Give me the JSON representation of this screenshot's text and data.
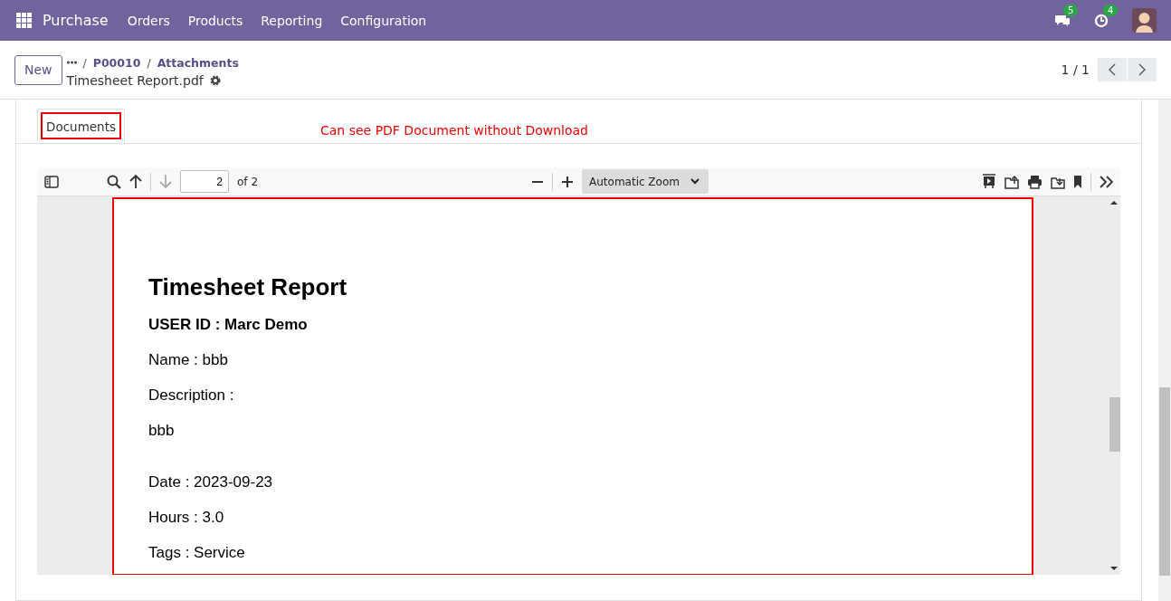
{
  "top_bar": {
    "app": "Purchase",
    "menu": [
      "Orders",
      "Products",
      "Reporting",
      "Configuration"
    ],
    "messages_badge": "5",
    "activities_badge": "4"
  },
  "control_panel": {
    "new_button": "New",
    "breadcrumb": [
      {
        "separator": "/",
        "label": "P00010"
      },
      {
        "separator": "/",
        "label": "Attachments"
      }
    ],
    "record_title": "Timesheet Report.pdf",
    "pager": "1 / 1"
  },
  "tabs": [
    {
      "label": "Documents",
      "selected": true
    }
  ],
  "annotation": "Can see PDF Document without Download",
  "pdf_viewer": {
    "page_number": "2",
    "page_count": "of 2",
    "zoom": "Automatic Zoom",
    "document": {
      "title": "Timesheet Report",
      "lines": [
        {
          "kind": "heading",
          "text": "USER ID : Marc Demo"
        },
        {
          "kind": "field",
          "text": "Name : bbb"
        },
        {
          "kind": "multiline",
          "text": "Description :",
          "value": "bbb"
        },
        {
          "kind": "field",
          "text": "Date : 2023-09-23"
        },
        {
          "kind": "field",
          "text": "Hours : 3.0"
        },
        {
          "kind": "field",
          "text": "Tags : Service"
        }
      ]
    }
  }
}
